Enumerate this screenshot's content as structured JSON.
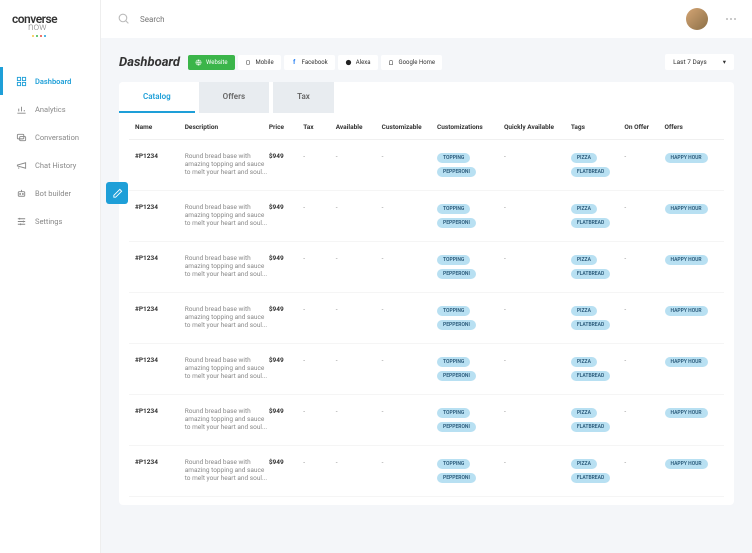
{
  "brand": {
    "name": "converse",
    "sub": "now"
  },
  "sidebar": {
    "items": [
      {
        "label": "Dashboard",
        "active": true
      },
      {
        "label": "Analytics"
      },
      {
        "label": "Conversation"
      },
      {
        "label": "Chat History"
      },
      {
        "label": "Bot builder"
      },
      {
        "label": "Settings"
      }
    ]
  },
  "search": {
    "placeholder": "Search"
  },
  "page": {
    "title": "Dashboard"
  },
  "channels": [
    {
      "label": "Website",
      "primary": true
    },
    {
      "label": "Mobile"
    },
    {
      "label": "Facebook"
    },
    {
      "label": "Alexa"
    },
    {
      "label": "Google Home"
    }
  ],
  "date_filter": {
    "label": "Last 7 Days"
  },
  "tabs": [
    {
      "label": "Catalog",
      "active": true
    },
    {
      "label": "Offers"
    },
    {
      "label": "Tax"
    }
  ],
  "table": {
    "headers": {
      "name": "Name",
      "description": "Description",
      "price": "Price",
      "tax": "Tax",
      "available": "Available",
      "customizable": "Customizable",
      "customizations": "Customizations",
      "quickly_available": "Quickly Available",
      "tags": "Tags",
      "on_offer": "On Offer",
      "offers": "Offers"
    },
    "rows": [
      {
        "name": "#P1234",
        "description": "Round bread base with amazing topping and sauce to melt your heart and soul...",
        "price": "$949",
        "tax": "-",
        "available": "-",
        "customizable": "-",
        "customizations": [
          "TOPPING",
          "PEPPERONI"
        ],
        "quickly_available": "-",
        "tags": [
          "PIZZA",
          "FLATBREAD"
        ],
        "on_offer": "-",
        "offers": [
          "HAPPY HOUR"
        ]
      },
      {
        "name": "#P1234",
        "description": "Round bread base with amazing topping and sauce to melt your heart and soul...",
        "price": "$949",
        "tax": "-",
        "available": "-",
        "customizable": "-",
        "customizations": [
          "TOPPING",
          "PEPPERONI"
        ],
        "quickly_available": "-",
        "tags": [
          "PIZZA",
          "FLATBREAD"
        ],
        "on_offer": "-",
        "offers": [
          "HAPPY HOUR"
        ]
      },
      {
        "name": "#P1234",
        "description": "Round bread base with amazing topping and sauce to melt your heart and soul...",
        "price": "$949",
        "tax": "-",
        "available": "-",
        "customizable": "-",
        "customizations": [
          "TOPPING",
          "PEPPERONI"
        ],
        "quickly_available": "-",
        "tags": [
          "PIZZA",
          "FLATBREAD"
        ],
        "on_offer": "-",
        "offers": [
          "HAPPY HOUR"
        ]
      },
      {
        "name": "#P1234",
        "description": "Round bread base with amazing topping and sauce to melt your heart and soul...",
        "price": "$949",
        "tax": "-",
        "available": "-",
        "customizable": "-",
        "customizations": [
          "TOPPING",
          "PEPPERONI"
        ],
        "quickly_available": "-",
        "tags": [
          "PIZZA",
          "FLATBREAD"
        ],
        "on_offer": "-",
        "offers": [
          "HAPPY HOUR"
        ]
      },
      {
        "name": "#P1234",
        "description": "Round bread base with amazing topping and sauce to melt your heart and soul...",
        "price": "$949",
        "tax": "-",
        "available": "-",
        "customizable": "-",
        "customizations": [
          "TOPPING",
          "PEPPERONI"
        ],
        "quickly_available": "-",
        "tags": [
          "PIZZA",
          "FLATBREAD"
        ],
        "on_offer": "-",
        "offers": [
          "HAPPY HOUR"
        ]
      },
      {
        "name": "#P1234",
        "description": "Round bread base with amazing topping and sauce to melt your heart and soul...",
        "price": "$949",
        "tax": "-",
        "available": "-",
        "customizable": "-",
        "customizations": [
          "TOPPING",
          "PEPPERONI"
        ],
        "quickly_available": "-",
        "tags": [
          "PIZZA",
          "FLATBREAD"
        ],
        "on_offer": "-",
        "offers": [
          "HAPPY HOUR"
        ]
      },
      {
        "name": "#P1234",
        "description": "Round bread base with amazing topping and sauce to melt your heart and soul...",
        "price": "$949",
        "tax": "-",
        "available": "-",
        "customizable": "-",
        "customizations": [
          "TOPPING",
          "PEPPERONI"
        ],
        "quickly_available": "-",
        "tags": [
          "PIZZA",
          "FLATBREAD"
        ],
        "on_offer": "-",
        "offers": [
          "HAPPY HOUR"
        ]
      }
    ]
  }
}
